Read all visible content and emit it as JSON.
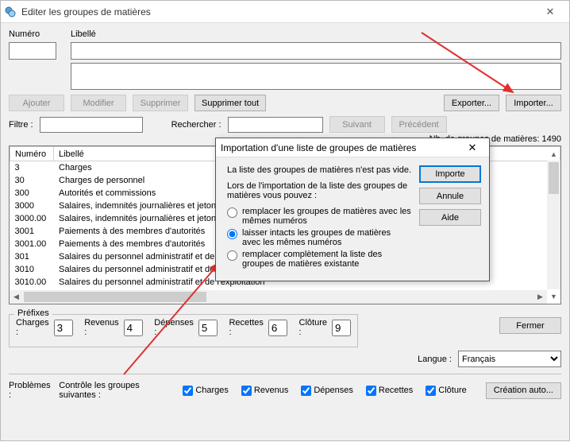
{
  "window": {
    "title": "Editer les groupes de matières",
    "close_aria": "Fermer"
  },
  "top": {
    "numero_label": "Numéro",
    "libelle_label": "Libellé"
  },
  "buttons": {
    "ajouter": "Ajouter",
    "modifier": "Modifier",
    "supprimer": "Supprimer",
    "supprimer_tout": "Supprimer tout",
    "exporter": "Exporter...",
    "importer": "Importer..."
  },
  "search": {
    "filtre_label": "Filtre :",
    "rechercher_label": "Rechercher :",
    "suivant": "Suivant",
    "precedent": "Précédent"
  },
  "count": {
    "label": "Nb. de groupes de matières:",
    "value": "1490"
  },
  "table": {
    "col_num": "Numéro",
    "col_lib": "Libellé",
    "rows": [
      {
        "n": "3",
        "l": "Charges"
      },
      {
        "n": "30",
        "l": "Charges de personnel"
      },
      {
        "n": "300",
        "l": "Autorités et commissions"
      },
      {
        "n": "3000",
        "l": "Salaires, indemnités journalières et jetons de présence"
      },
      {
        "n": "3000.00",
        "l": "Salaires, indemnités journalières et jetons de présence"
      },
      {
        "n": "3001",
        "l": "Paiements à des membres d'autorités"
      },
      {
        "n": "3001.00",
        "l": "Paiements à des membres d'autorités"
      },
      {
        "n": "301",
        "l": "Salaires du personnel administratif et de l'exploitation"
      },
      {
        "n": "3010",
        "l": "Salaires du personnel administratif et de l'exploitation"
      },
      {
        "n": "3010.00",
        "l": "Salaires du personnel administratif et de l'exploitation"
      }
    ]
  },
  "prefixes": {
    "legend": "Préfixes",
    "charges_label": "Charges :",
    "charges_val": "3",
    "revenus_label": "Revenus :",
    "revenus_val": "4",
    "depenses_label": "Dépenses :",
    "depenses_val": "5",
    "recettes_label": "Recettes :",
    "recettes_val": "6",
    "cloture_label": "Clôture :",
    "cloture_val": "9"
  },
  "footer": {
    "fermer": "Fermer",
    "langue_label": "Langue :",
    "langue_value": "Français",
    "problemes_label": "Problèmes :",
    "controle_label": "Contrôle les groupes suivantes :",
    "chk_charges": "Charges",
    "chk_revenus": "Revenus",
    "chk_depenses": "Dépenses",
    "chk_recettes": "Recettes",
    "chk_cloture": "Clôture",
    "creation_auto": "Création auto..."
  },
  "dialog": {
    "title": "Importation d'une liste de groupes de matières",
    "line1": "La liste des groupes de matières n'est pas vide.",
    "line2": "Lors de l'importation de la liste des groupes de matières vous pouvez :",
    "opt1": "remplacer les groupes de matières avec les mêmes numéros",
    "opt2": "laisser intacts les groupes de matières avec les mêmes numéros",
    "opt3": "remplacer complètement la liste des groupes de matières existante",
    "btn_import": "Importe",
    "btn_cancel": "Annule",
    "btn_help": "Aide"
  }
}
